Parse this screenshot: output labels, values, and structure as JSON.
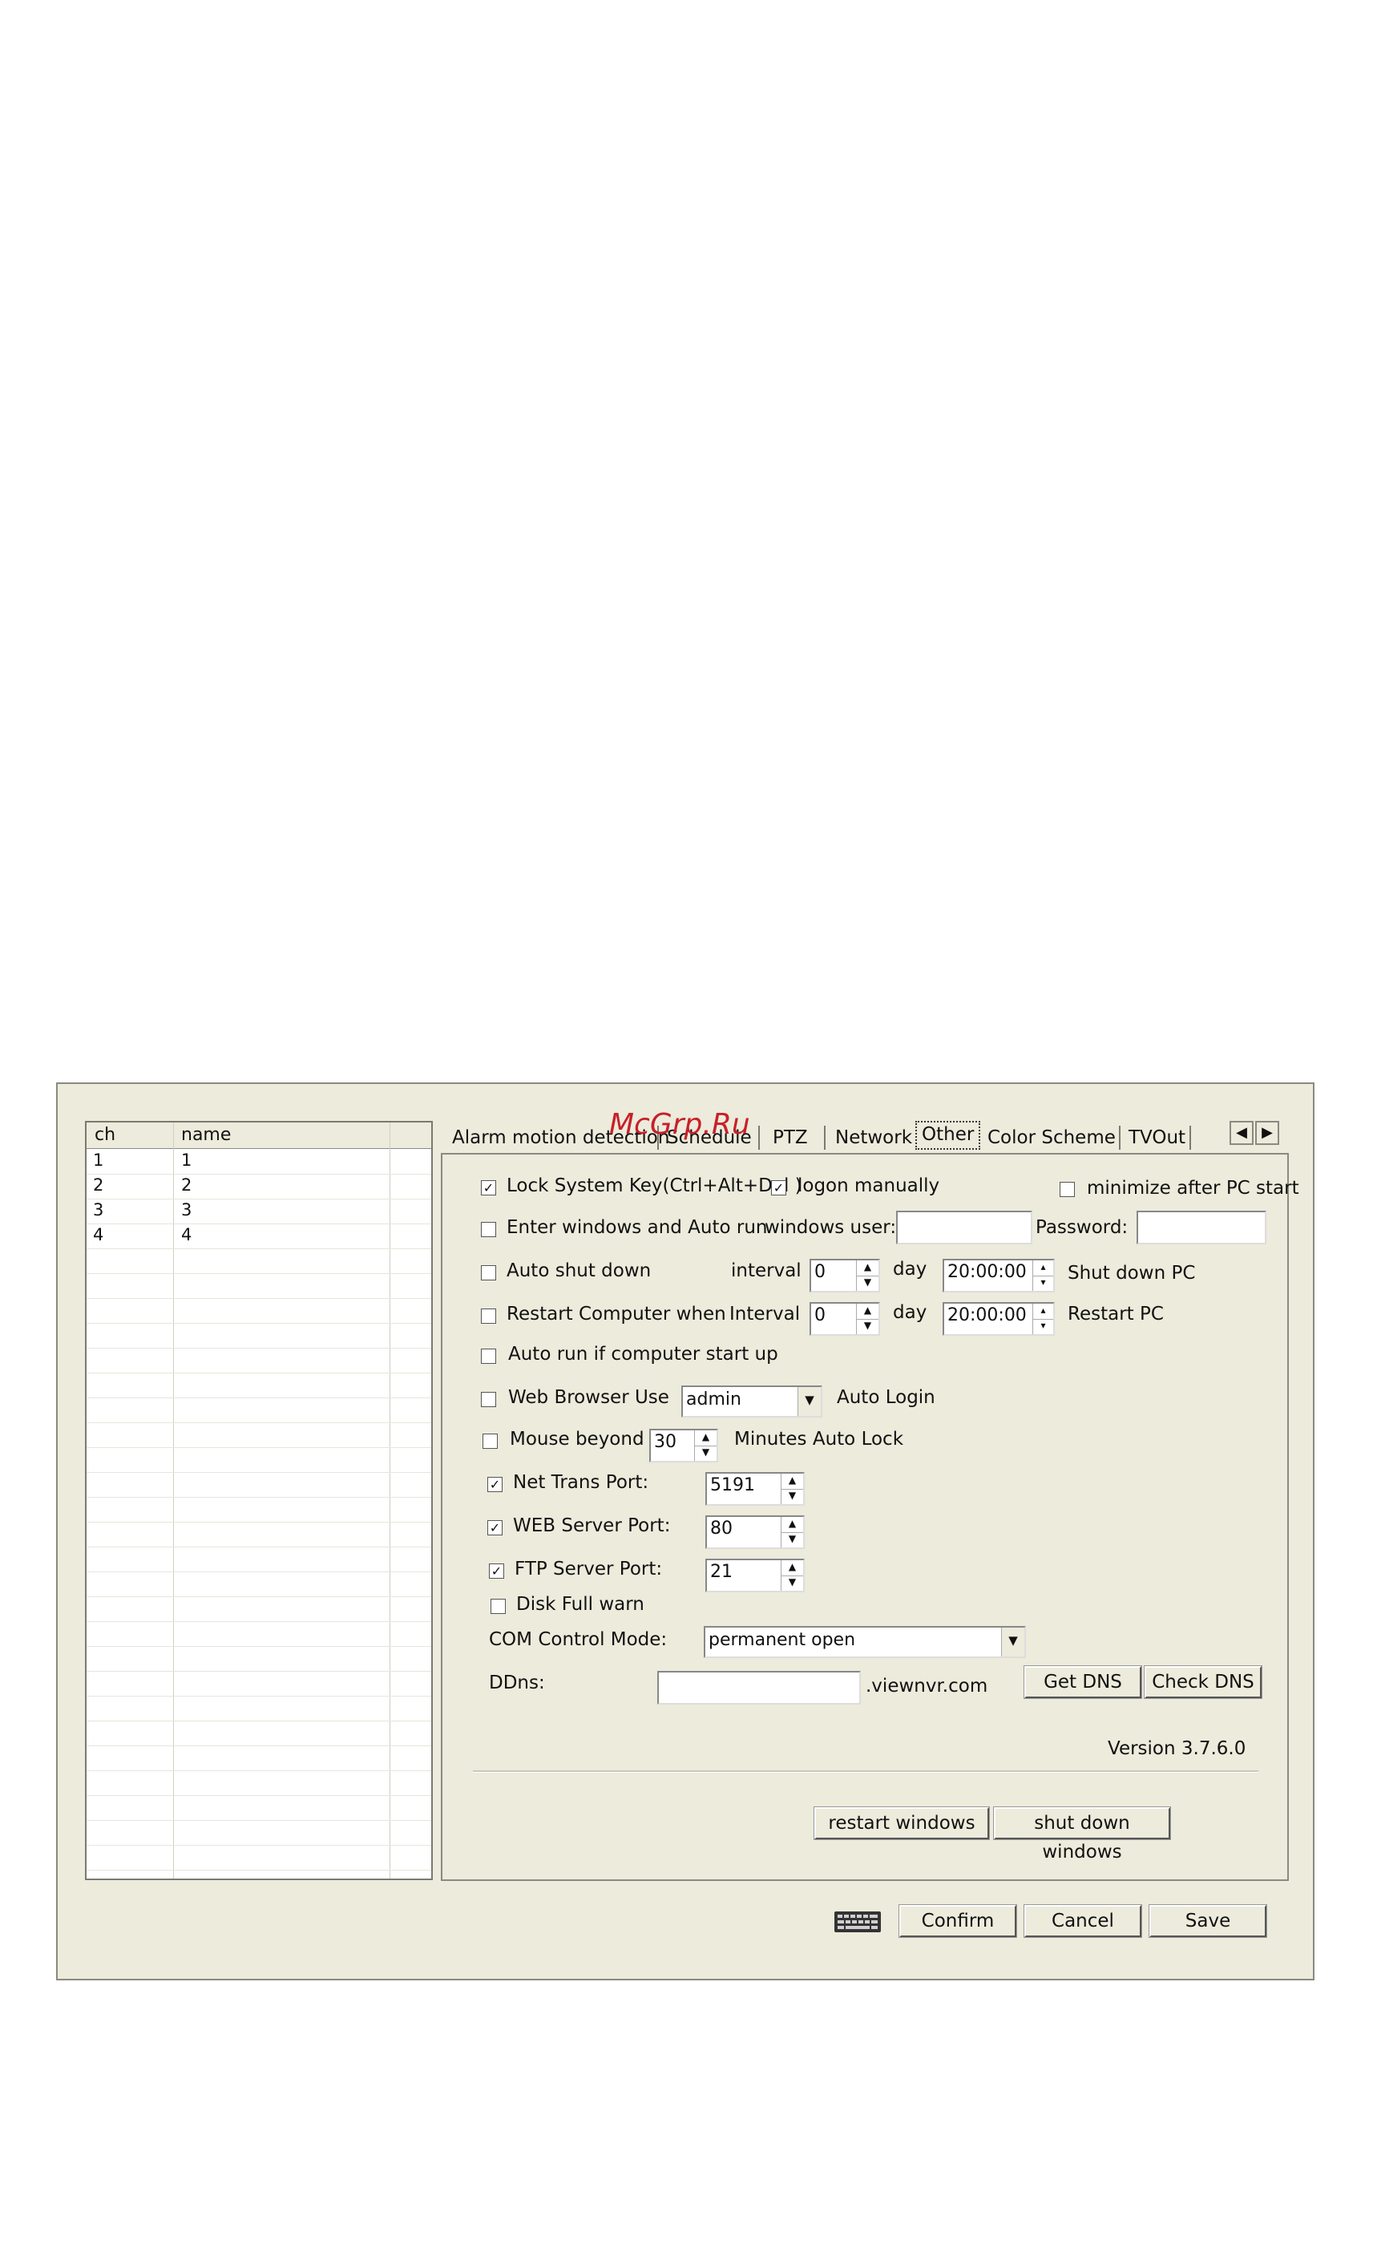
{
  "watermark": "McGrp.Ru",
  "channel_list": {
    "columns": [
      "ch",
      "name"
    ],
    "rows": [
      {
        "ch": "1",
        "name": "1"
      },
      {
        "ch": "2",
        "name": "2"
      },
      {
        "ch": "3",
        "name": "3"
      },
      {
        "ch": "4",
        "name": "4"
      }
    ]
  },
  "tabs": [
    "Alarm motion detection",
    "Schedule",
    "PTZ",
    "Network",
    "Other",
    "Color Scheme",
    "TVOut"
  ],
  "active_tab": "Other",
  "tab_nav": {
    "left_icon": "arrow-left-icon",
    "right_icon": "arrow-right-icon"
  },
  "other": {
    "lock_system_key": {
      "label": "Lock System Key(Ctrl+Alt+Del )",
      "checked": true
    },
    "logon_manually": {
      "label": "logon manually",
      "checked": true
    },
    "minimize_after_start": {
      "label": "minimize after PC start",
      "checked": false
    },
    "enter_windows": {
      "label": "Enter windows and Auto run",
      "checked": false,
      "user_label": "windows user:",
      "user_value": "",
      "password_label": "Password:",
      "password_value": ""
    },
    "auto_shutdown": {
      "label": "Auto shut down",
      "checked": false,
      "interval_label": "interval",
      "interval_value": "0",
      "day_label": "day",
      "time_value": "20:00:00",
      "action_label": "Shut down PC"
    },
    "restart_computer": {
      "label": "Restart Computer  when",
      "checked": false,
      "interval_label": "Interval",
      "interval_value": "0",
      "day_label": "day",
      "time_value": "20:00:00",
      "action_label": "Restart PC"
    },
    "auto_run": {
      "label": "Auto run if computer start up",
      "checked": false
    },
    "web_browser": {
      "label": "Web Browser  Use",
      "checked": false,
      "user_value": "admin",
      "suffix_label": "Auto Login"
    },
    "mouse_beyond": {
      "label": "Mouse beyond",
      "checked": false,
      "value": "30",
      "suffix_label": "Minutes  Auto Lock"
    },
    "net_trans_port": {
      "label": "Net Trans Port:",
      "checked": true,
      "value": "5191"
    },
    "web_server_port": {
      "label": "WEB Server Port:",
      "checked": true,
      "value": "80"
    },
    "ftp_server_port": {
      "label": "FTP Server Port:",
      "checked": true,
      "value": "21"
    },
    "disk_full_warn": {
      "label": "Disk Full warn",
      "checked": false
    },
    "com_control": {
      "label": "COM Control Mode:",
      "value": "permanent open"
    },
    "ddns": {
      "label": "DDns:",
      "value": "",
      "suffix": ".viewnvr.com",
      "get_dns": "Get DNS",
      "check_dns": "Check DNS"
    },
    "version": "Version 3.7.6.0",
    "restart_windows": "restart windows",
    "shutdown_windows": "shut down windows"
  },
  "footer": {
    "keyboard_icon": "keyboard-icon",
    "confirm": "Confirm",
    "cancel": "Cancel",
    "save": "Save"
  }
}
